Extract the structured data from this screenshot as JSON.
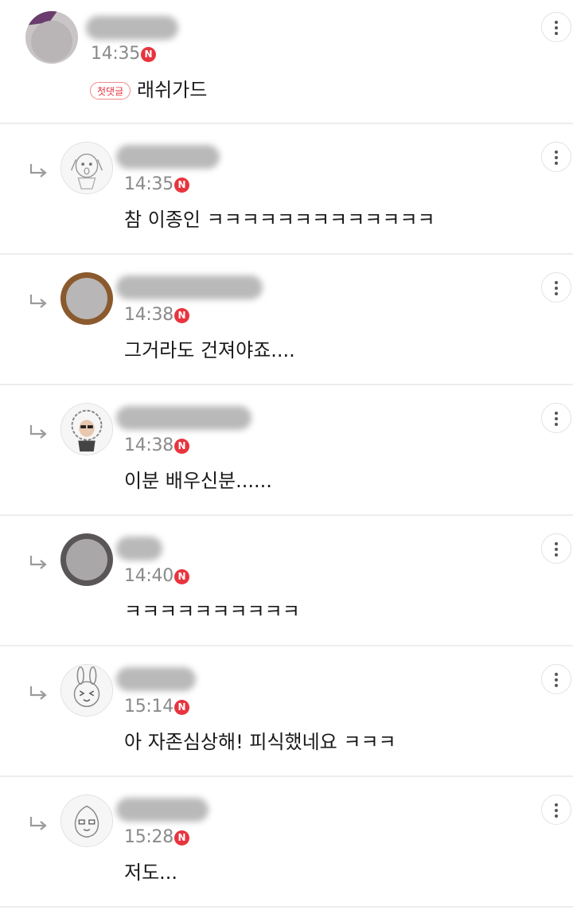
{
  "comments": [
    {
      "time": "14:35",
      "new_badge": "N",
      "first_comment_badge": "첫댓글",
      "text": "래쉬가드",
      "avatar": "blurred-photo-avatar",
      "is_reply": false
    },
    {
      "time": "14:35",
      "new_badge": "N",
      "text": "참 이종인 ㅋㅋㅋㅋㅋㅋㅋㅋㅋㅋㅋㅋㅋ",
      "avatar": "dog-character-avatar",
      "is_reply": true
    },
    {
      "time": "14:38",
      "new_badge": "N",
      "text": "그거라도 건져야죠....",
      "avatar": "blurred-photo-avatar",
      "is_reply": true
    },
    {
      "time": "14:38",
      "new_badge": "N",
      "text": "이분 배우신분......",
      "avatar": "curly-hair-character-avatar",
      "is_reply": true
    },
    {
      "time": "14:40",
      "new_badge": "N",
      "text": "ㅋㅋㅋㅋㅋㅋㅋㅋㅋㅋ",
      "avatar": "blurred-photo-avatar",
      "is_reply": true
    },
    {
      "time": "15:14",
      "new_badge": "N",
      "text": "아 자존심상해! 피식했네요 ㅋㅋㅋ",
      "avatar": "rabbit-character-avatar",
      "is_reply": true
    },
    {
      "time": "15:28",
      "new_badge": "N",
      "text": "저도...",
      "avatar": "peach-character-avatar",
      "is_reply": true
    }
  ],
  "icons": {
    "reply": "reply-arrow-icon",
    "more": "more-vertical-icon"
  },
  "colors": {
    "new_badge": "#e8343e",
    "timestamp": "#8a8a8a",
    "divider": "#ededed"
  }
}
